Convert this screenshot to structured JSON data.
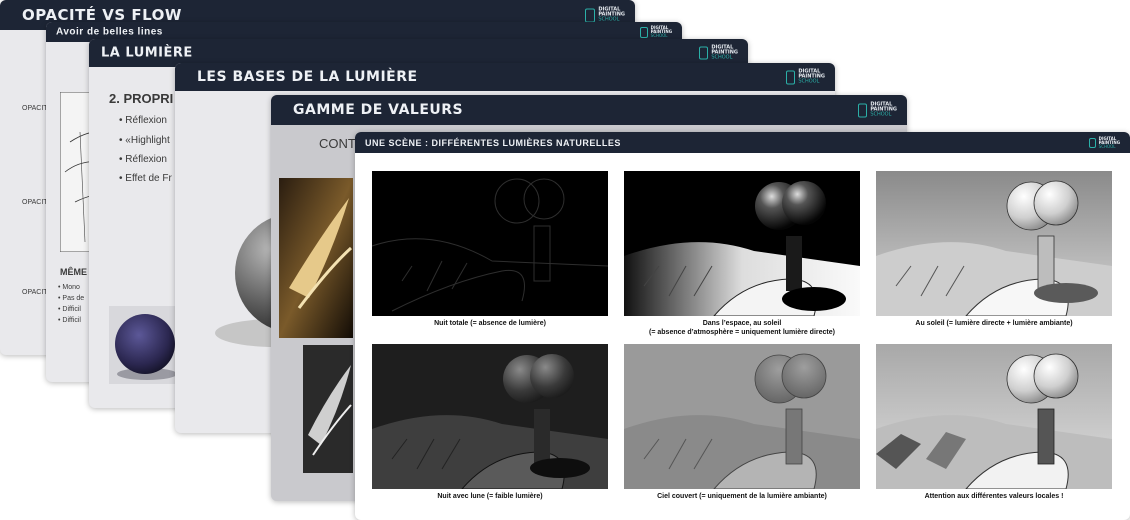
{
  "slides": [
    {
      "title": "OPACITÉ VS FLOW",
      "labels": [
        "OPACITÉ",
        "OPACITÉ",
        "OPACITÉ"
      ]
    },
    {
      "title": "Avoir de belles lines",
      "section": "MÊME",
      "bullets": [
        "Mono",
        "Pas de",
        "Difficil",
        "Difficil"
      ]
    },
    {
      "title": "LA LUMIÈRE",
      "section": "2. PROPRI",
      "bullets": [
        "Réflexion",
        "«Highlight",
        "Réflexion",
        "Effet de Fr"
      ]
    },
    {
      "title": "LES BASES DE LA LUMIÈRE"
    },
    {
      "title": "GAMME DE VALEURS",
      "subtitle": "CONT"
    },
    {
      "title": "UNE SCÈNE : DIFFÉRENTES LUMIÈRES NATURELLES",
      "panels": [
        {
          "caption_lines": [
            "Nuit totale (= absence de lumière)"
          ]
        },
        {
          "caption_lines": [
            "Dans l’espace, au soleil",
            "(= absence d’atmosphère = uniquement lumière directe)"
          ]
        },
        {
          "caption_lines": [
            "Au soleil (= lumière directe + lumière ambiante)"
          ]
        },
        {
          "caption_lines": [
            "Nuit avec lune (= faible lumière)"
          ]
        },
        {
          "caption_lines": [
            "Ciel couvert (= uniquement de la lumière ambiante)"
          ]
        },
        {
          "caption_lines": [
            "Attention aux différentes valeurs locales !"
          ]
        }
      ]
    }
  ],
  "logo": {
    "line1": "DIGITAL",
    "line2": "PAINTING",
    "line3": "SCHOOL",
    "accent_color": "#2bb0a8"
  },
  "colors": {
    "header_bg": "#1d2535",
    "slide_bg": "#e9e9ec"
  }
}
